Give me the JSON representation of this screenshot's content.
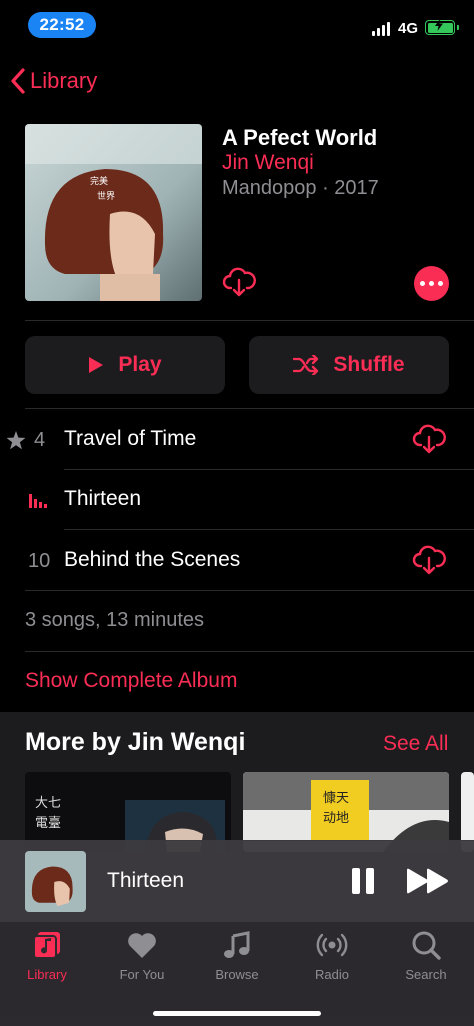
{
  "status_bar": {
    "time": "22:52",
    "network": "4G"
  },
  "nav": {
    "back_label": "Library"
  },
  "album": {
    "title": "A Pefect World",
    "artist": "Jin Wenqi",
    "meta": "Mandopop · 2017"
  },
  "actions": {
    "play_label": "Play",
    "shuffle_label": "Shuffle"
  },
  "tracks": [
    {
      "number": "4",
      "title": "Travel of Time",
      "starred": true,
      "downloadable": true
    },
    {
      "number": "",
      "title": "Thirteen",
      "now_playing": true,
      "downloadable": false
    },
    {
      "number": "10",
      "title": "Behind the Scenes",
      "downloadable": true
    }
  ],
  "summary": {
    "count_text": "3 songs, 13 minutes",
    "show_complete_label": "Show Complete Album"
  },
  "more_by": {
    "title": "More by Jin Wenqi",
    "see_all_label": "See All"
  },
  "mini_player": {
    "title": "Thirteen"
  },
  "tab_bar": {
    "items": [
      {
        "label": "Library",
        "icon": "library-icon",
        "active": true
      },
      {
        "label": "For You",
        "icon": "heart-icon",
        "active": false
      },
      {
        "label": "Browse",
        "icon": "music-note-icon",
        "active": false
      },
      {
        "label": "Radio",
        "icon": "radio-icon",
        "active": false
      },
      {
        "label": "Search",
        "icon": "search-icon",
        "active": false
      }
    ]
  },
  "colors": {
    "accent": "#fa2d55",
    "background": "#000000",
    "secondary_text": "#8e8e93",
    "card": "#1c1c1e"
  }
}
